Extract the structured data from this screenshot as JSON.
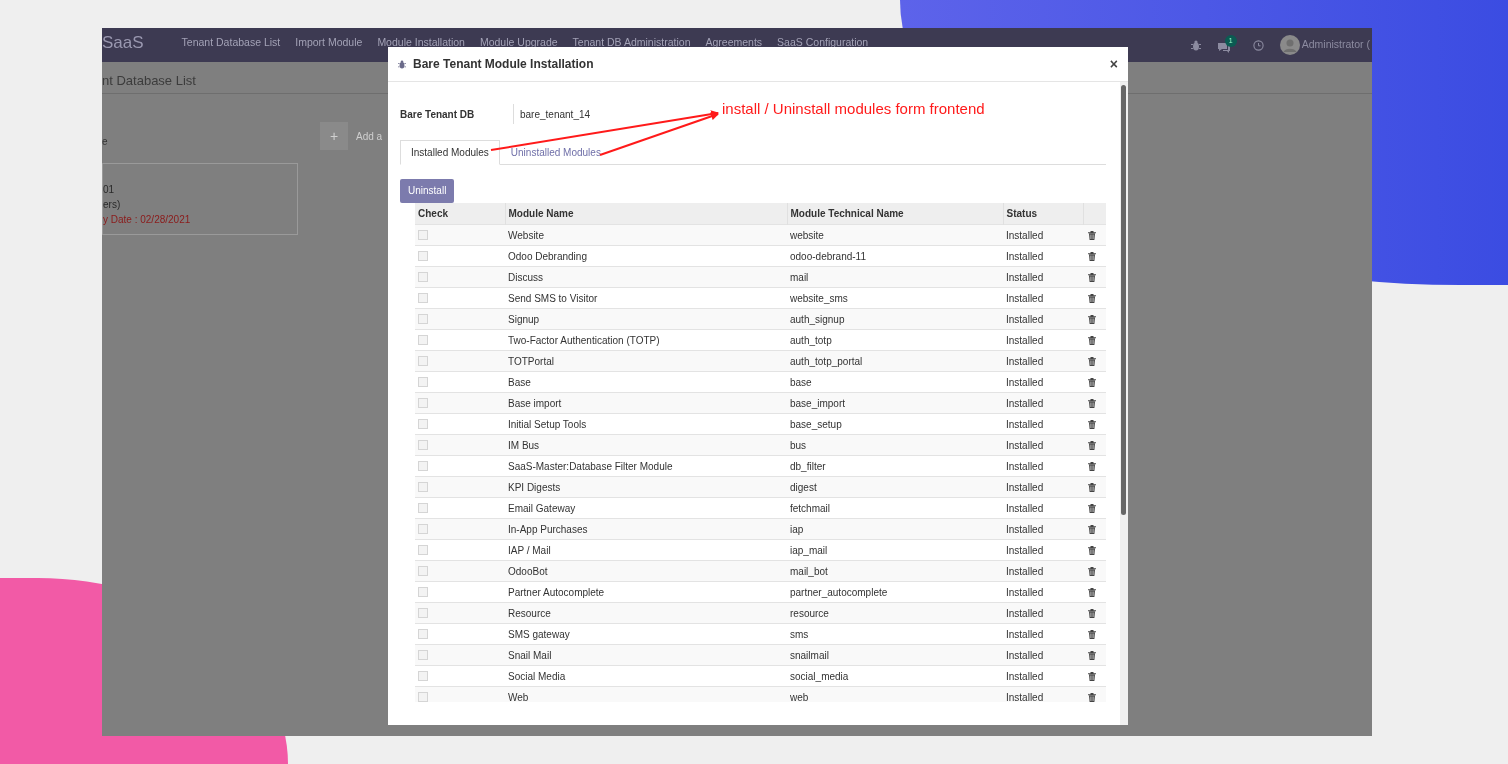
{
  "app": {
    "brand": "SaaS",
    "nav": [
      "Tenant Database List",
      "Import Module",
      "Module Installation",
      "Module Upgrade",
      "Tenant DB Administration",
      "Agreements",
      "SaaS Configuration"
    ],
    "notification_count": "1",
    "user": "Administrator ("
  },
  "background": {
    "breadcrumb": "nt Database List",
    "section_label": "e",
    "add_button": "+",
    "add_label": "Add a",
    "card": {
      "line_1": "01",
      "line_2": "ers)",
      "expiry": "y Date : 02/28/2021"
    }
  },
  "modal": {
    "title": "Bare Tenant Module Installation",
    "close": "×",
    "field": {
      "label": "Bare Tenant DB",
      "value": "bare_tenant_14"
    },
    "tabs": [
      {
        "label": "Installed Modules",
        "selected": true
      },
      {
        "label": "Uninstalled Modules",
        "selected": false
      }
    ],
    "action_button": "Uninstall",
    "table": {
      "columns": [
        "Check",
        "Module Name",
        "Module Technical Name",
        "Status"
      ],
      "rows": [
        {
          "name": "Website",
          "technical_name": "website",
          "status": "Installed",
          "checked": false
        },
        {
          "name": "Odoo Debranding",
          "technical_name": "odoo-debrand-11",
          "status": "Installed",
          "checked": false
        },
        {
          "name": "Discuss",
          "technical_name": "mail",
          "status": "Installed",
          "checked": false
        },
        {
          "name": "Send SMS to Visitor",
          "technical_name": "website_sms",
          "status": "Installed",
          "checked": false
        },
        {
          "name": "Signup",
          "technical_name": "auth_signup",
          "status": "Installed",
          "checked": false
        },
        {
          "name": "Two-Factor Authentication (TOTP)",
          "technical_name": "auth_totp",
          "status": "Installed",
          "checked": false
        },
        {
          "name": "TOTPortal",
          "technical_name": "auth_totp_portal",
          "status": "Installed",
          "checked": false
        },
        {
          "name": "Base",
          "technical_name": "base",
          "status": "Installed",
          "checked": false
        },
        {
          "name": "Base import",
          "technical_name": "base_import",
          "status": "Installed",
          "checked": false
        },
        {
          "name": "Initial Setup Tools",
          "technical_name": "base_setup",
          "status": "Installed",
          "checked": false
        },
        {
          "name": "IM Bus",
          "technical_name": "bus",
          "status": "Installed",
          "checked": false
        },
        {
          "name": "SaaS-Master:Database Filter Module",
          "technical_name": "db_filter",
          "status": "Installed",
          "checked": false
        },
        {
          "name": "KPI Digests",
          "technical_name": "digest",
          "status": "Installed",
          "checked": false
        },
        {
          "name": "Email Gateway",
          "technical_name": "fetchmail",
          "status": "Installed",
          "checked": false
        },
        {
          "name": "In-App Purchases",
          "technical_name": "iap",
          "status": "Installed",
          "checked": false
        },
        {
          "name": "IAP / Mail",
          "technical_name": "iap_mail",
          "status": "Installed",
          "checked": false
        },
        {
          "name": "OdooBot",
          "technical_name": "mail_bot",
          "status": "Installed",
          "checked": false
        },
        {
          "name": "Partner Autocomplete",
          "technical_name": "partner_autocomplete",
          "status": "Installed",
          "checked": false
        },
        {
          "name": "Resource",
          "technical_name": "resource",
          "status": "Installed",
          "checked": false
        },
        {
          "name": "SMS gateway",
          "technical_name": "sms",
          "status": "Installed",
          "checked": false
        },
        {
          "name": "Snail Mail",
          "technical_name": "snailmail",
          "status": "Installed",
          "checked": false
        },
        {
          "name": "Social Media",
          "technical_name": "social_media",
          "status": "Installed",
          "checked": false
        },
        {
          "name": "Web",
          "technical_name": "web",
          "status": "Installed",
          "checked": false
        }
      ]
    }
  },
  "annotation": {
    "text": "install / Uninstall modules form frontend"
  }
}
